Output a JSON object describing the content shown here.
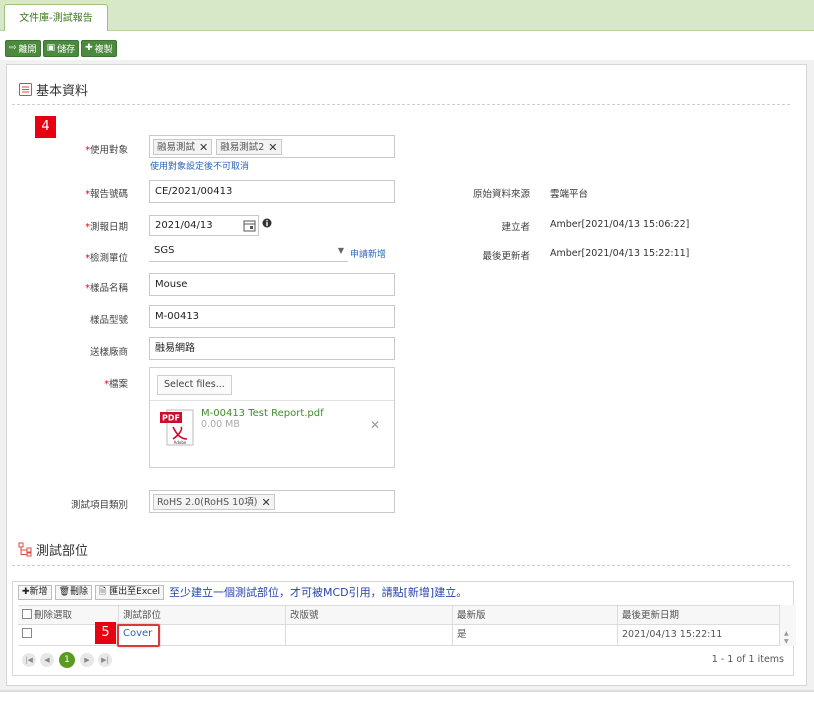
{
  "tab": {
    "label": "文件庫-測試報告"
  },
  "toolbar": {
    "leave": "離開",
    "save": "儲存",
    "copy": "複製"
  },
  "sections": {
    "basic_title": "基本資料",
    "parts_title": "測試部位"
  },
  "badges": {
    "b4": "4",
    "b5": "5"
  },
  "form": {
    "target": {
      "label": "使用對象",
      "chips": [
        "融易測試",
        "融易測試2"
      ],
      "hint": "使用對象設定後不可取消"
    },
    "report_no": {
      "label": "報告號碼",
      "value": "CE/2021/00413"
    },
    "test_date": {
      "label": "測報日期",
      "value": "2021/04/13"
    },
    "lab": {
      "label": "檢測單位",
      "value": "SGS",
      "link": "申請新增"
    },
    "sample_name": {
      "label": "樣品名稱",
      "value": "Mouse"
    },
    "sample_model": {
      "label": "樣品型號",
      "value": "M-00413"
    },
    "supplier": {
      "label": "送樣廠商",
      "value": "融易網路"
    },
    "files": {
      "label": "檔案",
      "select_button": "Select files...",
      "file_name": "M-00413 Test Report.pdf",
      "file_size": "0.00 MB",
      "pdf_badge": "PDF",
      "adobe_text": "Adobe"
    },
    "test_category": {
      "label": "測試項目類別",
      "chips": [
        "RoHS 2.0(RoHS 10項)"
      ]
    }
  },
  "info": {
    "source": {
      "label": "原始資料來源",
      "value": "雲端平台"
    },
    "creator": {
      "label": "建立者",
      "value": "Amber[2021/04/13 15:06:22]"
    },
    "updater": {
      "label": "最後更新者",
      "value": "Amber[2021/04/13 15:22:11]"
    }
  },
  "grid": {
    "add": "新增",
    "delete": "刪除",
    "export": "匯出至Excel",
    "message": "至少建立一個測試部位，才可被MCD引用，請點[新增]建立。",
    "columns": [
      "刪除選取",
      "測試部位",
      "改版號",
      "最新版",
      "最後更新日期"
    ],
    "rows": [
      {
        "part": "Cover",
        "rev": "",
        "latest": "是",
        "updated": "2021/04/13 15:22:11"
      }
    ],
    "pager": {
      "current": "1",
      "info": "1 - 1 of 1 items"
    }
  },
  "colors": {
    "accent": "#4c8a3f",
    "link": "#2a65b8",
    "required": "#e60012",
    "highlight": "#d83b3b"
  }
}
